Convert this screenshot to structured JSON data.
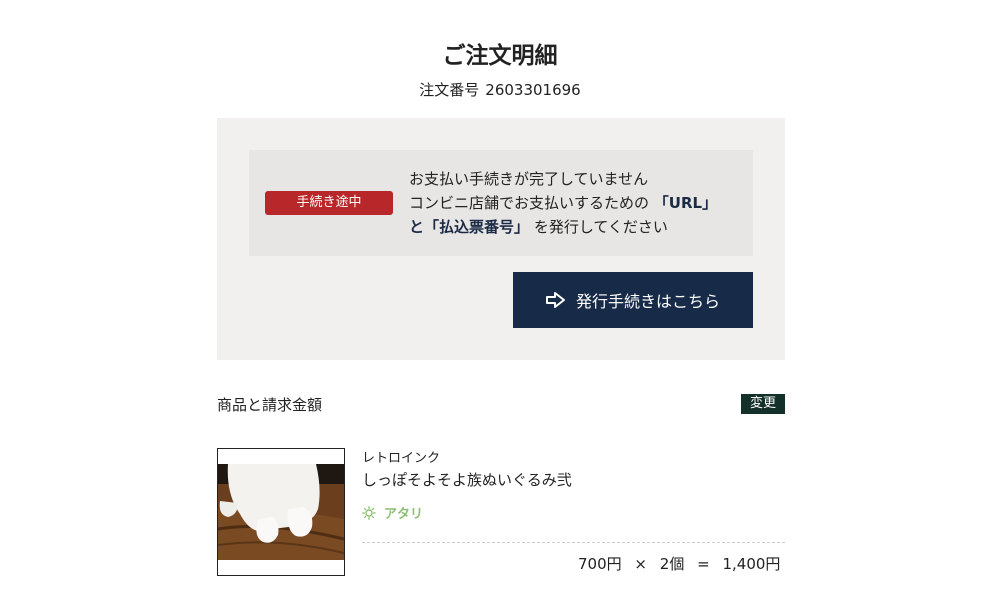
{
  "header": {
    "title": "ご注文明細",
    "order_label": "注文番号",
    "order_number": "2603301696"
  },
  "status": {
    "badge": "手続き途中",
    "line1": "お支払い手続きが完了していません",
    "line2_prefix": "コンビニ店舗でお支払いするための",
    "line2_url": "「URL」",
    "line3_prefix": "と",
    "line3_bold": "「払込票番号」",
    "line3_suffix": "を発行してください",
    "button_label": "発行手続きはこちら",
    "button_icon": "arrow-right-outline-icon",
    "badge_color": "#b8282b",
    "button_color": "#172a47"
  },
  "items_section": {
    "title": "商品と請求金額",
    "change_label": "変更",
    "change_color": "#14302a"
  },
  "product": {
    "brand": "レトロインク",
    "name": "しっぽそよそよ族ぬいぐるみ弐",
    "variant_icon": "sun-icon",
    "variant": "アタリ",
    "variant_color": "#8cbf73",
    "unit_price": "700円",
    "times": "×",
    "quantity": "2個",
    "equals": "=",
    "total": "1,400円"
  }
}
